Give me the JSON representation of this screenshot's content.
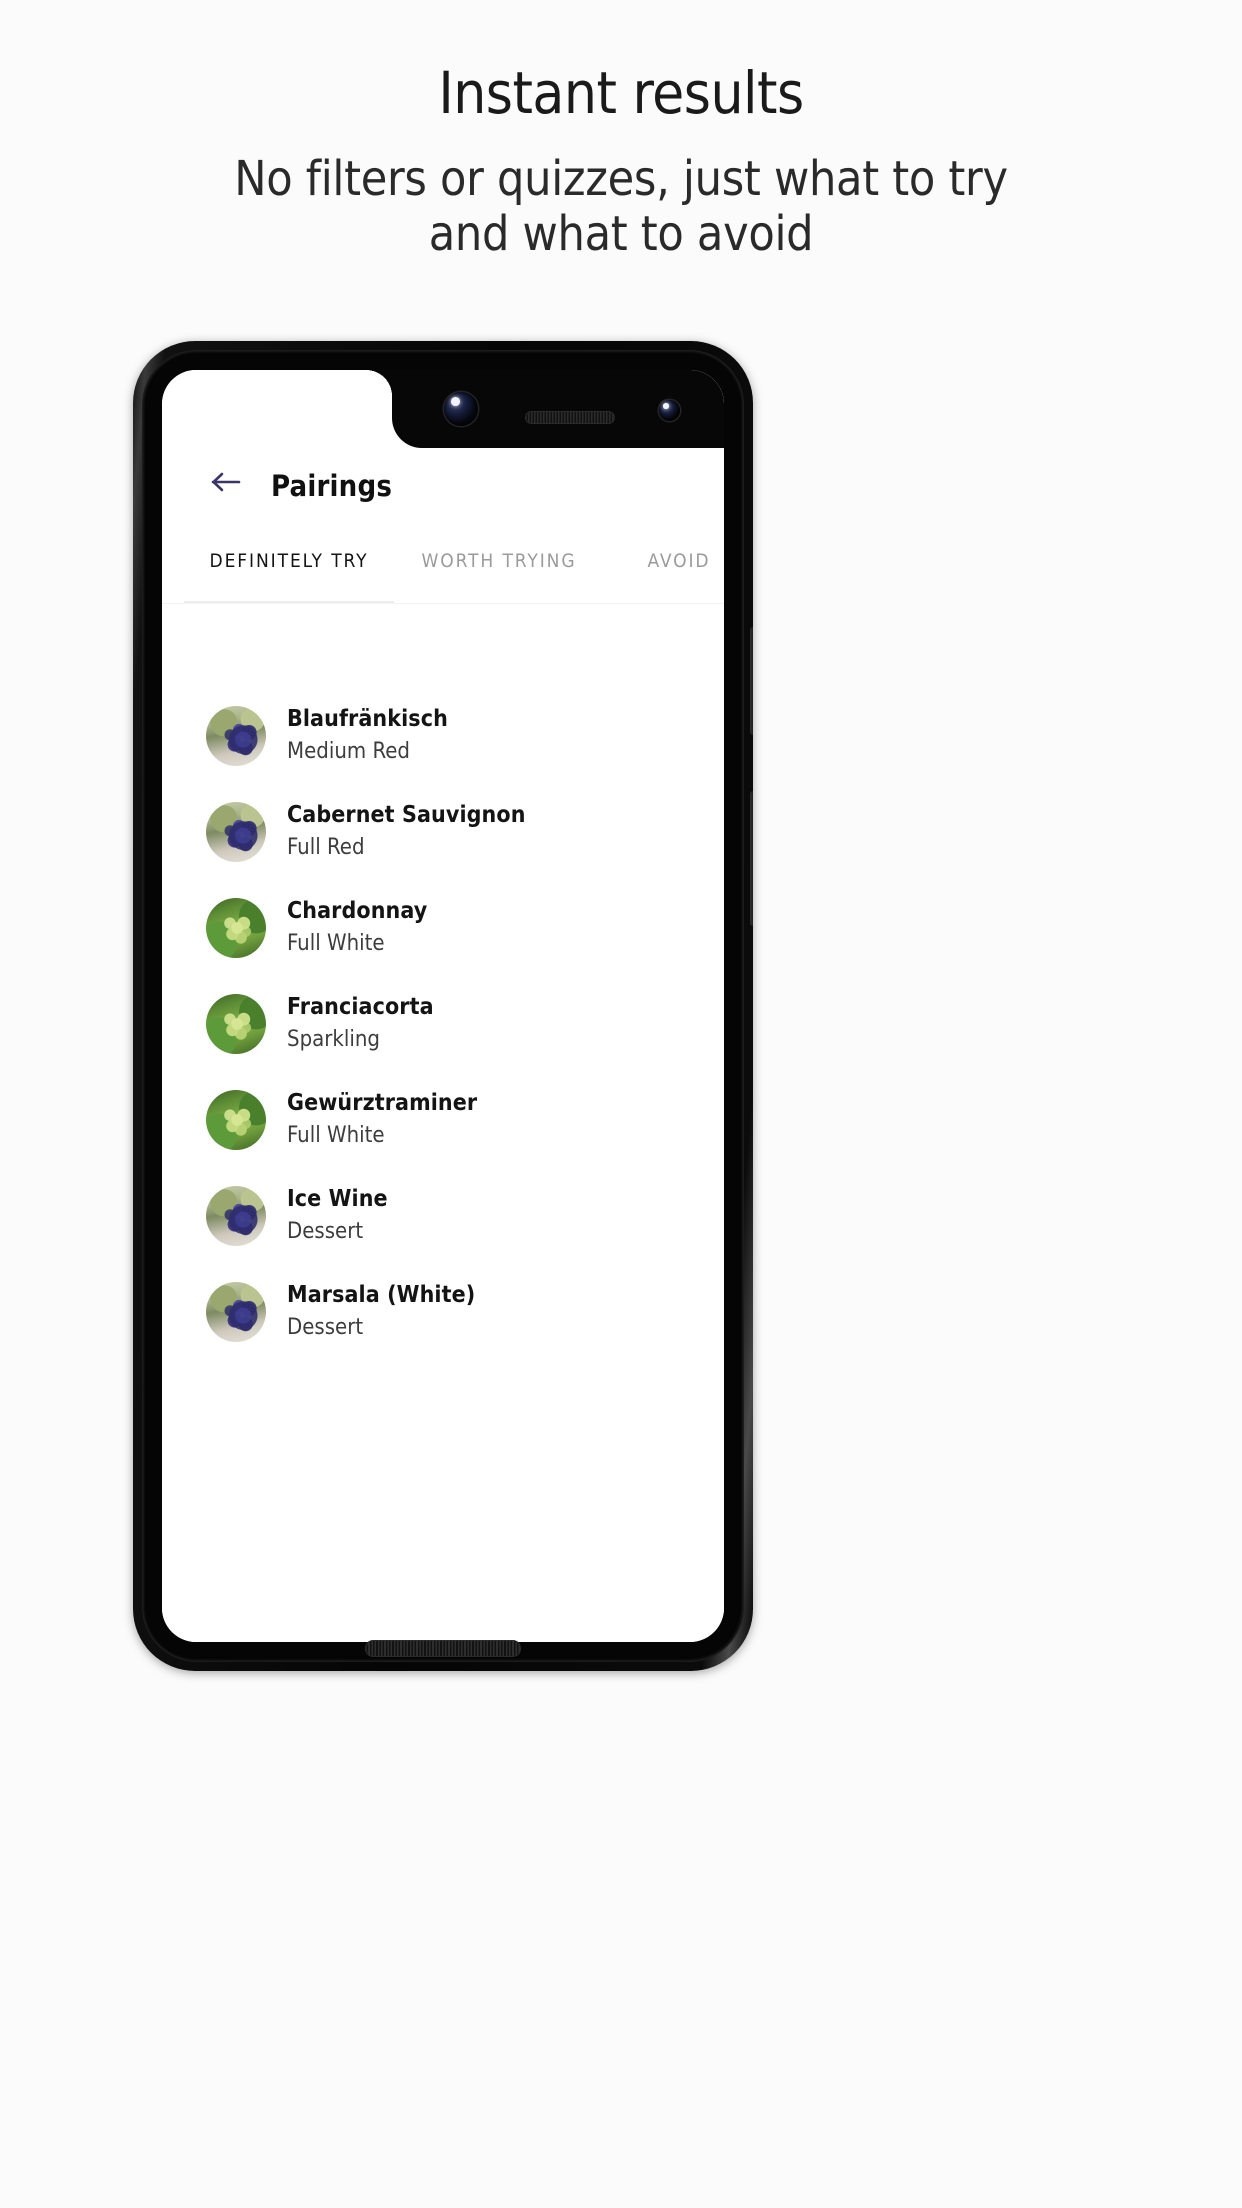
{
  "promo": {
    "title": "Instant results",
    "subtitle": "No filters or quizzes, just what to try and what to avoid"
  },
  "colors": {
    "page_background": "#fbfbfb",
    "back_arrow": "#3b3668",
    "tab_active_text": "#141414",
    "tab_inactive_text": "#9b9b9b",
    "screen_background": "#ffffff"
  },
  "device": {
    "frame_color": "#0a0a0a",
    "notch_color": "#070707"
  },
  "app": {
    "appbar": {
      "back_icon": "arrow-left-icon",
      "title": "Pairings"
    },
    "tabs": [
      {
        "label": "DEFINITELY TRY",
        "active": true
      },
      {
        "label": "WORTH TRYING",
        "active": false
      },
      {
        "label": "AVOID",
        "active": false
      }
    ],
    "list": [
      {
        "name": "Blaufränkisch",
        "type": "Medium Red",
        "thumb": "red-grapes-icon"
      },
      {
        "name": "Cabernet Sauvignon",
        "type": "Full Red",
        "thumb": "red-grapes-icon"
      },
      {
        "name": "Chardonnay",
        "type": "Full White",
        "thumb": "green-grapes-icon"
      },
      {
        "name": "Franciacorta",
        "type": "Sparkling",
        "thumb": "green-grapes-icon"
      },
      {
        "name": "Gewürztraminer",
        "type": "Full White",
        "thumb": "green-grapes-icon"
      },
      {
        "name": "Ice Wine",
        "type": "Dessert",
        "thumb": "red-grapes-icon"
      },
      {
        "name": "Marsala (White)",
        "type": "Dessert",
        "thumb": "red-grapes-icon"
      }
    ]
  }
}
